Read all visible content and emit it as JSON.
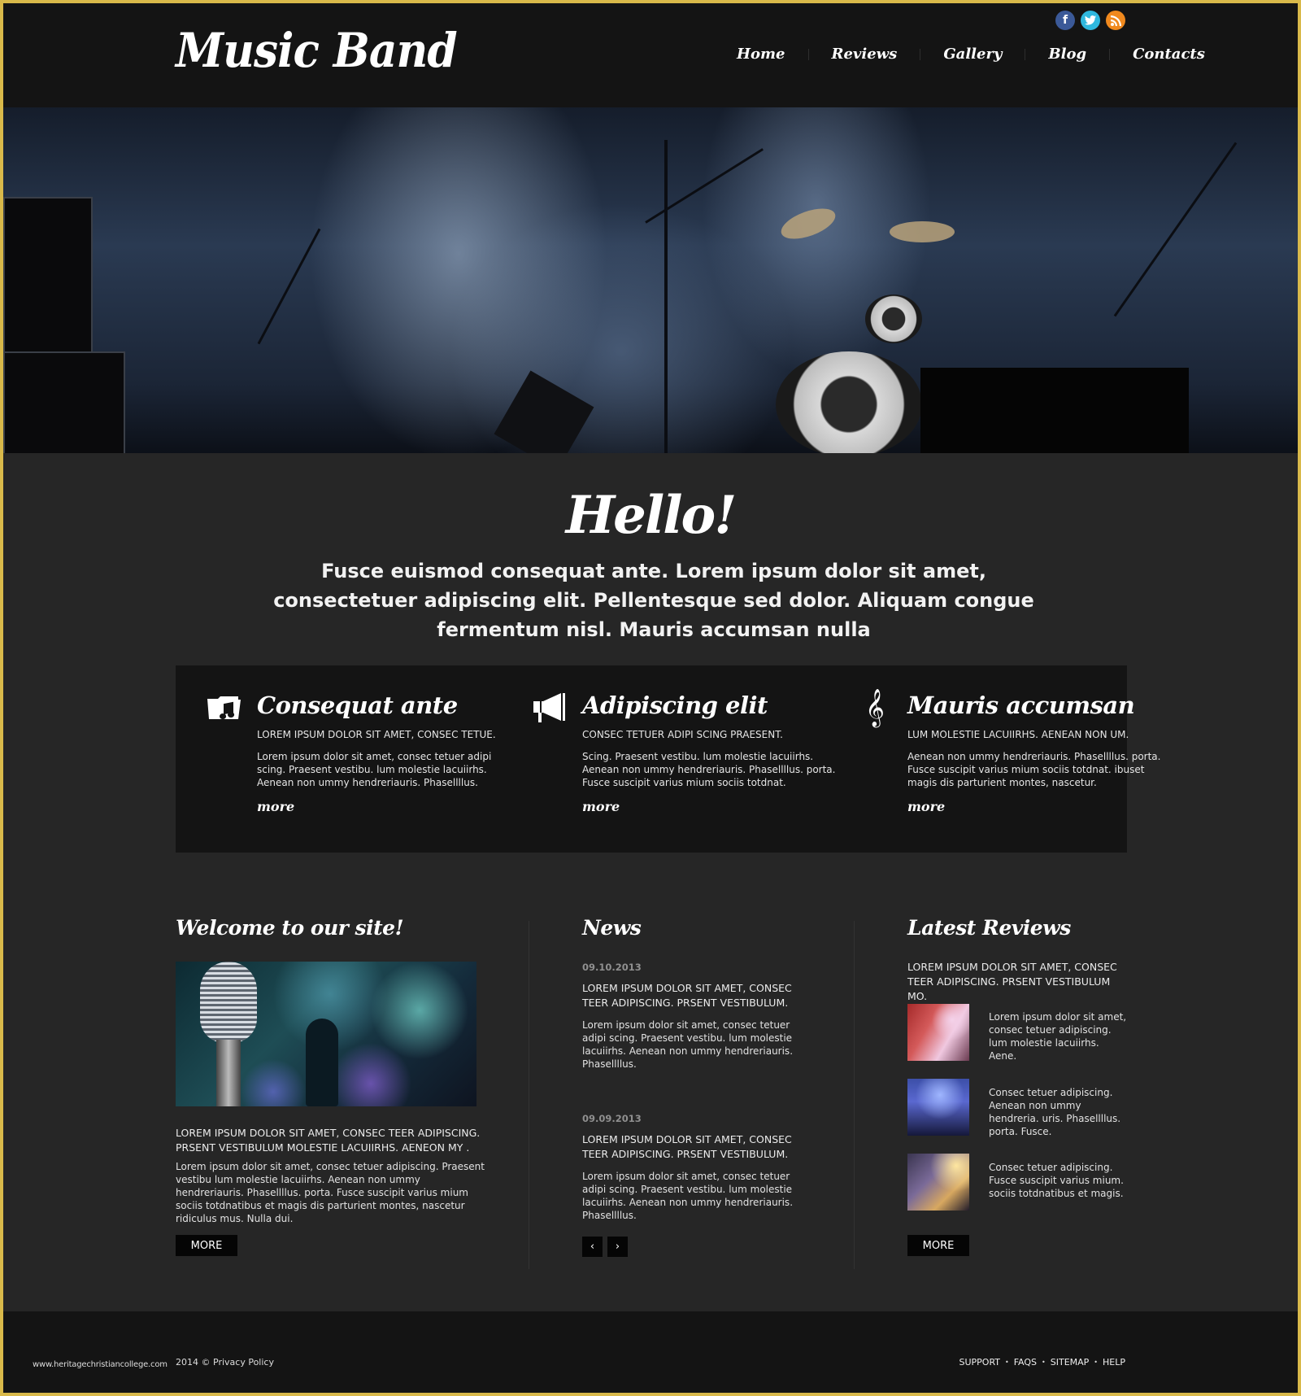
{
  "header": {
    "logo": "Music Band",
    "social": [
      {
        "name": "facebook-icon",
        "glyph": "f"
      },
      {
        "name": "twitter-icon",
        "glyph": "t"
      },
      {
        "name": "rss-icon",
        "glyph": ")"
      }
    ],
    "nav": [
      "Home",
      "Reviews",
      "Gallery",
      "Blog",
      "Contacts"
    ]
  },
  "hello": {
    "title": "Hello!",
    "text": "Fusce euismod consequat ante. Lorem ipsum dolor sit amet, consectetuer adipiscing elit. Pellentesque sed dolor. Aliquam congue fermentum nisl. Mauris accumsan nulla"
  },
  "features": [
    {
      "icon": "music-folder-icon",
      "title": "Consequat ante",
      "caption": "LOREM IPSUM DOLOR SIT AMET, CONSEC TETUE.",
      "text": "Lorem ipsum dolor sit amet, consec tetuer adipi scing. Praesent vestibu.  lum molestie lacuiirhs. Aenean non ummy hendreriauris. Phasellllus.",
      "more": "more"
    },
    {
      "icon": "megaphone-icon",
      "title": "Adipiscing elit",
      "caption": "CONSEC TETUER ADIPI SCING PRAESENT.",
      "text": "Scing. Praesent vestibu.  lum molestie lacuiirhs. Aenean non ummy hendreriauris. Phasellllus. porta. Fusce suscipit varius mium sociis totdnat.",
      "more": "more"
    },
    {
      "icon": "treble-clef-icon",
      "title": "Mauris accumsan",
      "caption": "LUM MOLESTIE LACUIIRHS. AENEAN NON UM.",
      "text": "Aenean non ummy hendreriauris. Phasellllus. porta. Fusce suscipit varius mium sociis totdnat. ibuset magis dis parturient montes, nascetur.",
      "more": "more"
    }
  ],
  "welcome": {
    "title": "Welcome  to our site!",
    "caption": "LOREM IPSUM DOLOR SIT AMET, CONSEC TEER ADIPISCING. PRSENT VESTIBULUM MOLESTIE LACUIIRHS. AENEON MY .",
    "text": "Lorem ipsum dolor sit amet, consec tetuer adipiscing. Praesent vestibu lum molestie lacuiirhs. Aenean non ummy hendreriauris. Phasellllus. porta. Fusce suscipit varius mium sociis totdnatibus et magis dis parturient montes, nascetur ridiculus mus. Nulla dui.",
    "button": "MORE"
  },
  "news": {
    "title": "News",
    "items": [
      {
        "date": "09.10.2013",
        "caption": "LOREM IPSUM DOLOR SIT AMET, CONSEC TEER ADIPISCING. PRSENT VESTIBULUM.",
        "text": "Lorem ipsum dolor sit amet, consec tetuer adipi scing. Praesent vestibu.  lum molestie lacuiirhs. Aenean non ummy hendreriauris. Phasellllus."
      },
      {
        "date": "09.09.2013",
        "caption": "LOREM IPSUM DOLOR SIT AMET, CONSEC TEER ADIPISCING. PRSENT VESTIBULUM.",
        "text": "Lorem ipsum dolor sit amet, consec tetuer adipi scing. Praesent vestibu.  lum molestie lacuiirhs. Aenean non ummy hendreriauris. Phasellllus."
      }
    ],
    "prev": "‹",
    "next": "›"
  },
  "reviews": {
    "title": "Latest Reviews",
    "caption": "LOREM IPSUM DOLOR SIT AMET, CONSEC TEER ADIPISCING. PRSENT VESTIBULUM MO.",
    "items": [
      {
        "text": "Lorem ipsum dolor sit amet, consec tetuer adipiscing. lum molestie lacuiirhs. Aene."
      },
      {
        "text": "Consec tetuer adipiscing. Aenean non ummy hendreria. uris. Phasellllus. porta. Fusce."
      },
      {
        "text": "Consec tetuer adipiscing. Fusce suscipit varius mium. sociis totdnatibus et magis."
      }
    ],
    "button": "MORE"
  },
  "footer": {
    "url": "www.heritagechristiancollege.com",
    "copyright": "2014 © ",
    "privacy": "Privacy Policy",
    "links": [
      "SUPPORT",
      "FAQS",
      "SITEMAP",
      "HELP"
    ],
    "separator": "•"
  }
}
